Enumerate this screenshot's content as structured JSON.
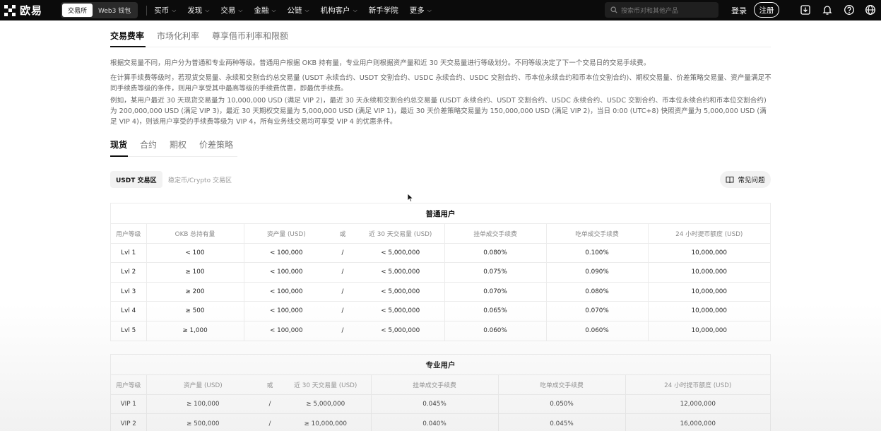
{
  "nav": {
    "logo_text": "欧易",
    "mode_tabs": [
      "交易所",
      "Web3 钱包"
    ],
    "menu": [
      {
        "label": "买币",
        "has_dropdown": true
      },
      {
        "label": "发现",
        "has_dropdown": true
      },
      {
        "label": "交易",
        "has_dropdown": true
      },
      {
        "label": "金融",
        "has_dropdown": true
      },
      {
        "label": "公链",
        "has_dropdown": true
      },
      {
        "label": "机构客户",
        "has_dropdown": true
      },
      {
        "label": "新手学院",
        "has_dropdown": false
      },
      {
        "label": "更多",
        "has_dropdown": true
      }
    ],
    "search_placeholder": "搜索币对和其他产品",
    "login": "登录",
    "register": "注册",
    "icons": [
      "download-icon",
      "bell-icon",
      "help-icon",
      "globe-icon"
    ]
  },
  "page_tabs": [
    "交易费率",
    "市场化利率",
    "尊享借币利率和限额"
  ],
  "intro": {
    "p1": "根据交易量不同，用户分为普通和专业两种等级。普通用户根据 OKB 持有量，专业用户则根据资产量和近 30 天交易量进行等级划分。不同等级决定了下一个交易日的交易手续费。",
    "p2": "在计算手续费等级时，若现货交易量、永续和交割合约总交易量 (USDT 永续合约、USDT 交割合约、USDC 永续合约、USDC 交割合约、币本位永续合约和币本位交割合约)、期权交易量、价差策略交易量、资产量满足不同手续费等级的条件，则用户享受其中最高等级的手续费优惠，即最优手续费。",
    "p3": "例如，某用户最近 30 天现货交易量为 10,000,000 USD (满足 VIP 2)，最近 30 天永续和交割合约总交易量 (USDT 永续合约、USDT 交割合约、USDC 永续合约、USDC 交割合约、币本位永续合约和币本位交割合约) 为 200,000,000 USD (满足 VIP 3)，最近 30 天期权交易量为 5,000,000 USD (满足 VIP 1)，最近 30 天价差策略交易量为 150,000,000 USD (满足 VIP 2)，当日 0:00 (UTC+8) 快照资产量为 5,000,000 USD (满足 VIP 4)，则该用户享受的手续费等级为 VIP 4，所有业务线交易均可享受 VIP 4 的优惠条件。"
  },
  "sub_tabs": [
    "现货",
    "合约",
    "期权",
    "价差策略"
  ],
  "zones": [
    "USDT 交易区",
    "稳定币/Crypto 交易区"
  ],
  "faq_label": "常见问题",
  "regular_table": {
    "title": "普通用户",
    "headers": [
      "用户等级",
      "OKB 总持有量",
      "资产量 (USD)",
      "或",
      "近 30 天交易量 (USD)",
      "挂单成交手续费",
      "吃单成交手续费",
      "24 小时提币额度 (USD)"
    ],
    "rows": [
      [
        "Lvl 1",
        "< 100",
        "< 100,000",
        "/",
        "< 5,000,000",
        "0.080%",
        "0.100%",
        "10,000,000"
      ],
      [
        "Lvl 2",
        "≥ 100",
        "< 100,000",
        "/",
        "< 5,000,000",
        "0.075%",
        "0.090%",
        "10,000,000"
      ],
      [
        "Lvl 3",
        "≥ 200",
        "< 100,000",
        "/",
        "< 5,000,000",
        "0.070%",
        "0.080%",
        "10,000,000"
      ],
      [
        "Lvl 4",
        "≥ 500",
        "< 100,000",
        "/",
        "< 5,000,000",
        "0.065%",
        "0.070%",
        "10,000,000"
      ],
      [
        "Lvl 5",
        "≥ 1,000",
        "< 100,000",
        "/",
        "< 5,000,000",
        "0.060%",
        "0.060%",
        "10,000,000"
      ]
    ]
  },
  "pro_table": {
    "title": "专业用户",
    "headers": [
      "用户等级",
      "资产量 (USD)",
      "或",
      "近 30 天交易量 (USD)",
      "挂单成交手续费",
      "吃单成交手续费",
      "24 小时提币额度 (USD)"
    ],
    "rows": [
      [
        "VIP 1",
        "≥ 100,000",
        "/",
        "≥ 5,000,000",
        "0.045%",
        "0.050%",
        "12,000,000"
      ],
      [
        "VIP 2",
        "≥ 500,000",
        "/",
        "≥ 10,000,000",
        "0.040%",
        "0.045%",
        "16,000,000"
      ]
    ]
  }
}
